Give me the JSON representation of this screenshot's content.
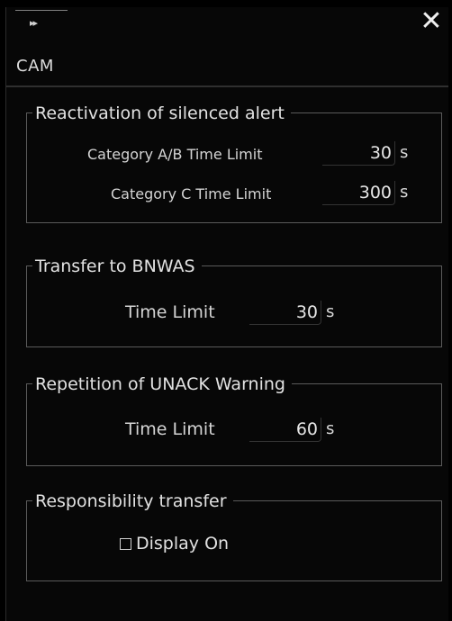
{
  "window": {
    "expand_icon_glyph": "▸▸",
    "close_icon_glyph": "✕",
    "title": "CAM"
  },
  "groups": {
    "reactivation": {
      "title": "Reactivation of silenced alert",
      "rows": [
        {
          "label": "Category A/B Time Limit",
          "value": "30",
          "unit": "s"
        },
        {
          "label": "Category C Time Limit",
          "value": "300",
          "unit": "s"
        }
      ]
    },
    "bnwas": {
      "title": "Transfer to BNWAS",
      "label": "Time Limit",
      "value": "30",
      "unit": "s"
    },
    "unack": {
      "title": "Repetition of UNACK Warning",
      "label": "Time Limit",
      "value": "60",
      "unit": "s"
    },
    "responsibility": {
      "title": "Responsibility transfer",
      "checkbox_label": "Display On",
      "checked": false
    }
  },
  "colors": {
    "background": "#000000",
    "panel": "#070707",
    "text": "#d9d9d9",
    "group_border": "#5a5a5a"
  }
}
